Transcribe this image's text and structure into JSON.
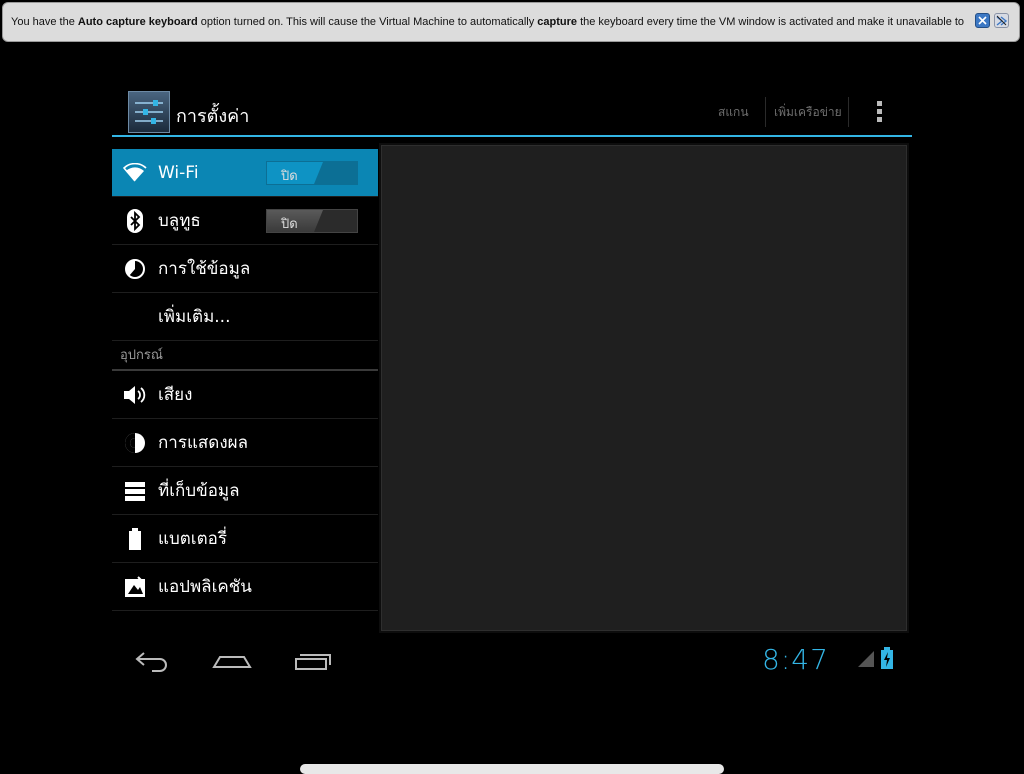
{
  "vm_notification": {
    "text_prefix": "You have the ",
    "bold_1": "Auto capture keyboard",
    "text_mid_1": " option turned on. This will cause the Virtual Machine to automatically ",
    "bold_2": "capture",
    "text_mid_2": " the keyboard every time the VM window is activated and make it unavailable to",
    "info_icon": "info-icon",
    "dismiss_icon": "dismiss-icon"
  },
  "actionbar": {
    "title": "การตั้งค่า",
    "scan": "สแกน",
    "add_network": "เพิ่มเครือข่าย",
    "overflow_icon": "overflow-menu-icon"
  },
  "settings": {
    "wireless": [
      {
        "label": "Wi-Fi",
        "icon": "wifi-icon",
        "toggle": "ปิด",
        "selected": true
      },
      {
        "label": "บลูทูธ",
        "icon": "bluetooth-icon",
        "toggle": "ปิด"
      },
      {
        "label": "การใช้ข้อมูล",
        "icon": "data-usage-icon"
      },
      {
        "label": "เพิ่มเติม..."
      }
    ],
    "device_header": "อุปกรณ์",
    "device": [
      {
        "label": "เสียง",
        "icon": "sound-icon"
      },
      {
        "label": "การแสดงผล",
        "icon": "display-icon"
      },
      {
        "label": "ที่เก็บข้อมูล",
        "icon": "storage-icon"
      },
      {
        "label": "แบตเตอรี่",
        "icon": "battery-icon"
      },
      {
        "label": "แอปพลิเคชัน",
        "icon": "apps-icon"
      }
    ]
  },
  "navbar": {
    "back_icon": "back-icon",
    "home_icon": "home-icon",
    "recents_icon": "recent-apps-icon",
    "time": "8:47"
  },
  "colors": {
    "accent": "#33b5e5",
    "selected_row": "#0b86b4",
    "background": "#000000"
  }
}
